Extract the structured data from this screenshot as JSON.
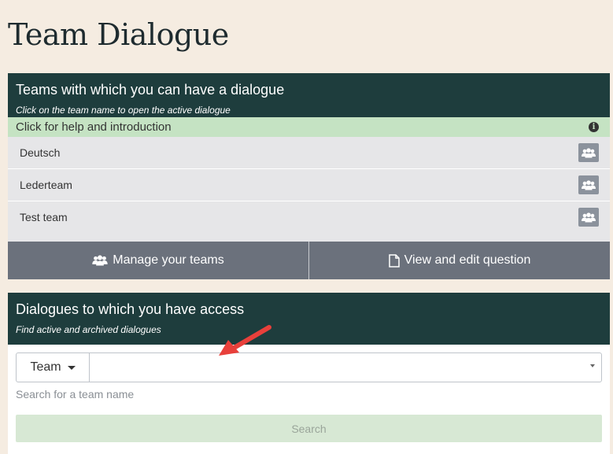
{
  "page": {
    "title": "Team Dialogue"
  },
  "teams_panel": {
    "heading": "Teams with which you can have a dialogue",
    "subheading": "Click on the team name to open the active dialogue",
    "help_bar": "Click for help and introduction",
    "teams": [
      {
        "name": "Deutsch"
      },
      {
        "name": "Lederteam"
      },
      {
        "name": "Test team"
      }
    ],
    "manage_label": "Manage your teams",
    "view_label": "View and edit question"
  },
  "dialogues_panel": {
    "heading": "Dialogues to which you have access",
    "subheading": "Find active and archived dialogues",
    "filter_label": "Team",
    "input_value": "",
    "hint": "Search for a team name",
    "search_label": "Search"
  },
  "colors": {
    "background": "#f5ece1",
    "panel_header": "#1e3d3d",
    "help_bar": "#c5e3c3",
    "action_button": "#6b717c",
    "search_button": "#d7e8d4",
    "arrow": "#e8403b"
  }
}
